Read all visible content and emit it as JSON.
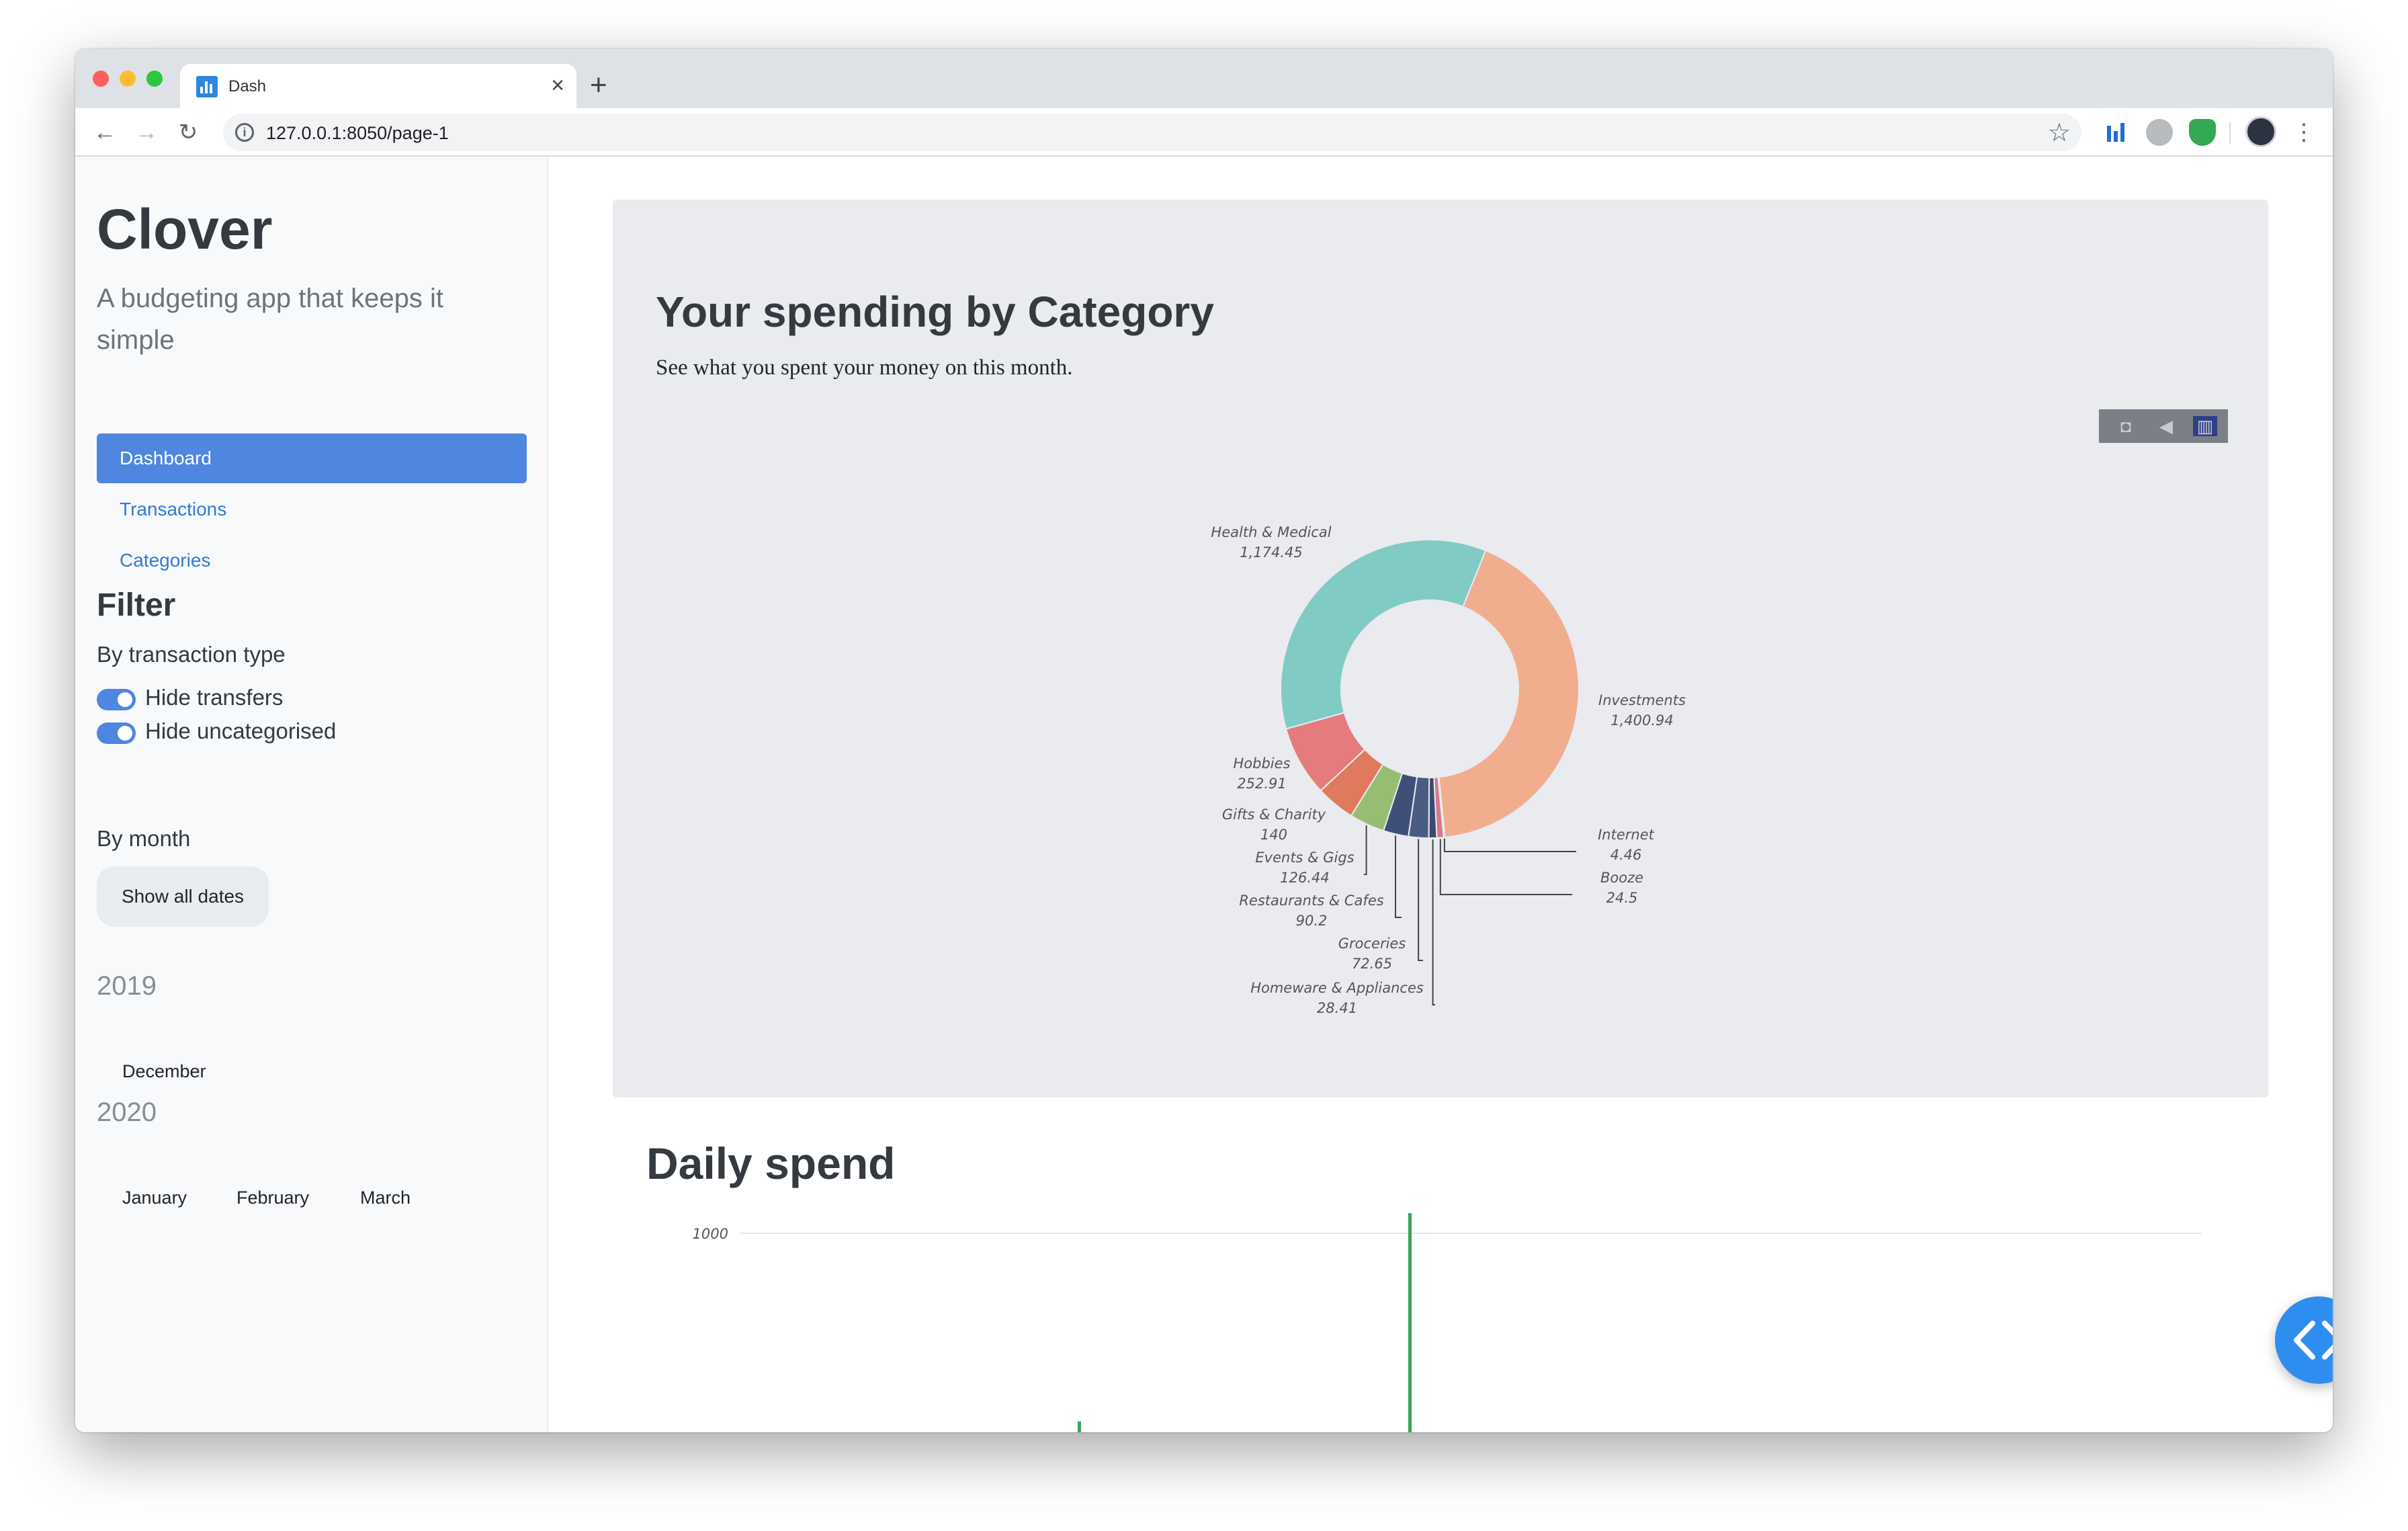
{
  "browser": {
    "tab_title": "Dash",
    "tab_close": "×",
    "new_tab": "+",
    "url": "127.0.0.1:8050/page-1"
  },
  "sidebar": {
    "title": "Clover",
    "subtitle": "A budgeting app that keeps it simple",
    "nav": [
      {
        "label": "Dashboard",
        "active": true
      },
      {
        "label": "Transactions",
        "active": false
      },
      {
        "label": "Categories",
        "active": false
      }
    ],
    "filter_title": "Filter",
    "by_type_label": "By transaction type",
    "toggles": [
      {
        "label": "Hide transfers",
        "on": true
      },
      {
        "label": "Hide uncategorised",
        "on": true
      }
    ],
    "by_month_label": "By month",
    "show_all_label": "Show all dates",
    "years": [
      {
        "year": "2019",
        "months": [
          "December"
        ]
      },
      {
        "year": "2020",
        "months": [
          "January",
          "February",
          "March"
        ]
      }
    ]
  },
  "main": {
    "card_title": "Your spending by Category",
    "card_subtitle": "See what you spent your money on this month.",
    "daily_title": "Daily spend"
  },
  "chart_data": [
    {
      "type": "pie",
      "hole": true,
      "slices": [
        {
          "label": "Investments",
          "value": 1400.94,
          "display": "1,400.94",
          "color": "#f0ae8e"
        },
        {
          "label": "Internet",
          "value": 4.46,
          "display": "4.46",
          "color": "#f7e6a0"
        },
        {
          "label": "Booze",
          "value": 24.5,
          "display": "24.5",
          "color": "#d9788a"
        },
        {
          "label": "Homeware & Appliances",
          "value": 28.41,
          "display": "28.41",
          "color": "#394a6d"
        },
        {
          "label": "Groceries",
          "value": 72.65,
          "display": "72.65",
          "color": "#4a5c82"
        },
        {
          "label": "Restaurants & Cafes",
          "value": 90.2,
          "display": "90.2",
          "color": "#3e4f78"
        },
        {
          "label": "Events & Gigs",
          "value": 126.44,
          "display": "126.44",
          "color": "#96bd72"
        },
        {
          "label": "Gifts & Charity",
          "value": 140,
          "display": "140",
          "color": "#e07a5f"
        },
        {
          "label": "Hobbies",
          "value": 252.91,
          "display": "252.91",
          "color": "#e57b7d"
        },
        {
          "label": "Health & Medical",
          "value": 1174.45,
          "display": "1,174.45",
          "color": "#80cbc4"
        }
      ]
    },
    {
      "type": "bar",
      "y_ticks": [
        1000
      ],
      "tick_labels": [
        "1000"
      ],
      "color": "#34a853"
    }
  ]
}
